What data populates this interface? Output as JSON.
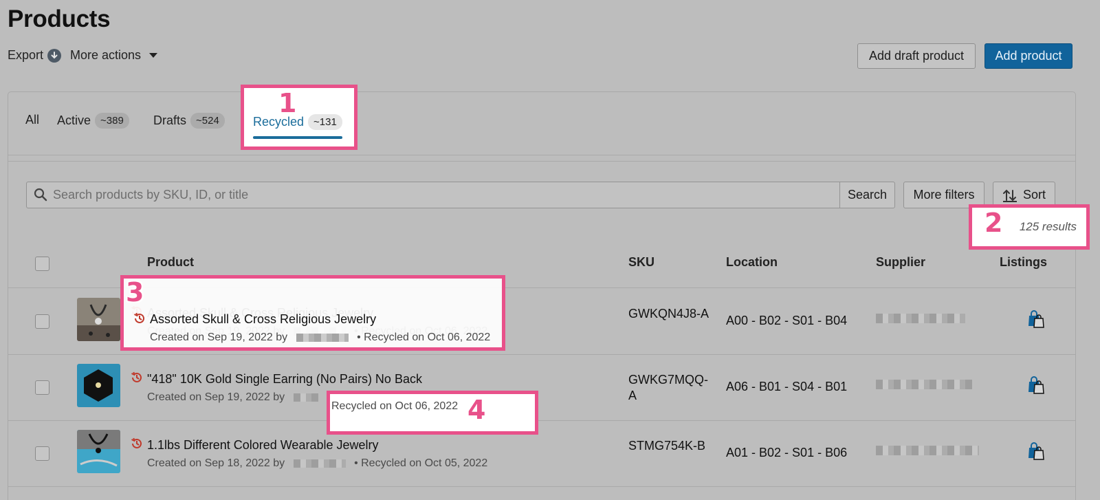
{
  "page": {
    "title": "Products"
  },
  "actions": {
    "export_label": "Export",
    "more_actions_label": "More actions",
    "add_draft_label": "Add draft product",
    "add_product_label": "Add product"
  },
  "tabs": [
    {
      "label": "All",
      "count": ""
    },
    {
      "label": "Active",
      "count": "~389"
    },
    {
      "label": "Drafts",
      "count": "~524"
    },
    {
      "label": "Recycled",
      "count": "~131",
      "active": true
    }
  ],
  "search": {
    "placeholder": "Search products by SKU, ID, or title",
    "button_label": "Search",
    "more_filters_label": "More filters",
    "sort_label": "Sort"
  },
  "results": {
    "text": "125 results"
  },
  "table": {
    "headers": {
      "product": "Product",
      "sku": "SKU",
      "location": "Location",
      "supplier": "Supplier",
      "listings": "Listings"
    },
    "rows": [
      {
        "title": "Assorted Skull & Cross Religious Jewelry",
        "created": "Created on Sep 19, 2022 by",
        "recycled": "• Recycled on Oct 06, 2022",
        "sku": "GWKQN4J8-A",
        "location": "A00 - B02 - S01 - B04"
      },
      {
        "title": "\"418\" 10K Gold Single Earring (No Pairs) No Back",
        "created": "Created on Sep 19, 2022 by",
        "recycled": "Recycled on Oct 06, 2022",
        "sku": "GWKG7MQQ-A",
        "location": "A06 - B01 - S04 - B01"
      },
      {
        "title": "1.1lbs Different Colored Wearable Jewelry",
        "created": "Created on Sep 18, 2022 by",
        "recycled": "• Recycled on Oct 05, 2022",
        "sku": "STMG754K-B",
        "location": "A01 - B02 - S01 - B06"
      }
    ]
  },
  "annotations": [
    "1",
    "2",
    "3",
    "4"
  ],
  "colors": {
    "accent": "#1b6d9b",
    "primary_button": "#11639b",
    "annotation": "#e8518a",
    "recycle_icon": "#c0392b"
  }
}
